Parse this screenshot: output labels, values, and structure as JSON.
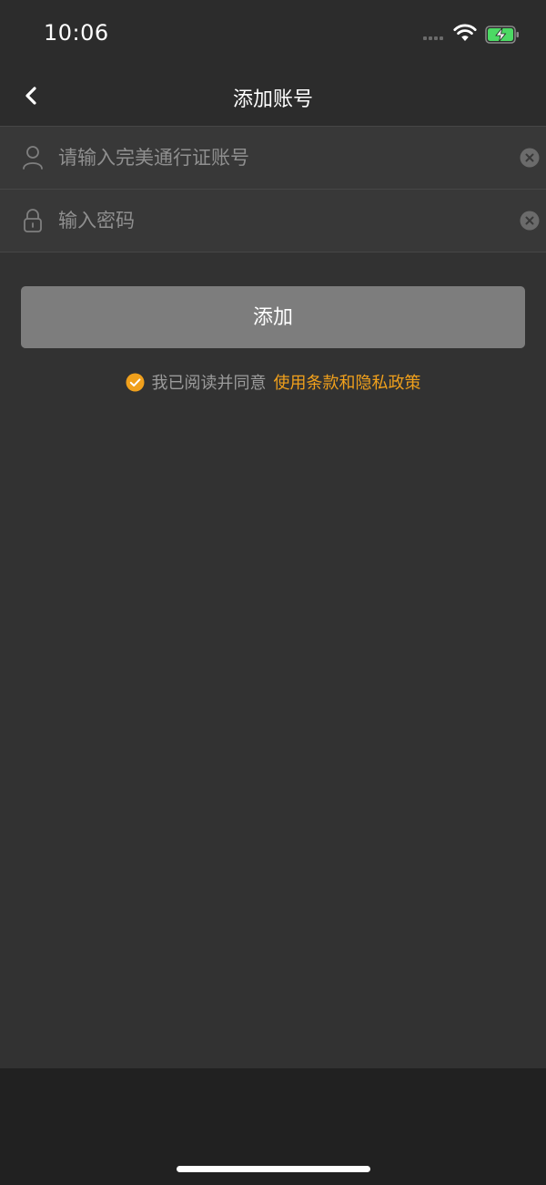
{
  "status_bar": {
    "time": "10:06",
    "icons": [
      "signal-dots-icon",
      "wifi-icon",
      "battery-charging-icon"
    ],
    "battery_color": "#4cd964"
  },
  "nav": {
    "back_icon": "chevron-left-icon",
    "title": "添加账号"
  },
  "form": {
    "account": {
      "icon": "user-icon",
      "placeholder": "请输入完美通行证账号",
      "value": "",
      "clear_icon": "clear-icon"
    },
    "password": {
      "icon": "lock-icon",
      "placeholder": "输入密码",
      "value": "",
      "clear_icon": "clear-icon"
    }
  },
  "add_button": {
    "label": "添加"
  },
  "agreement": {
    "checked": true,
    "text": "我已阅读并同意",
    "link_text": "使用条款和隐私政策",
    "accent_color": "#f0a01c"
  }
}
